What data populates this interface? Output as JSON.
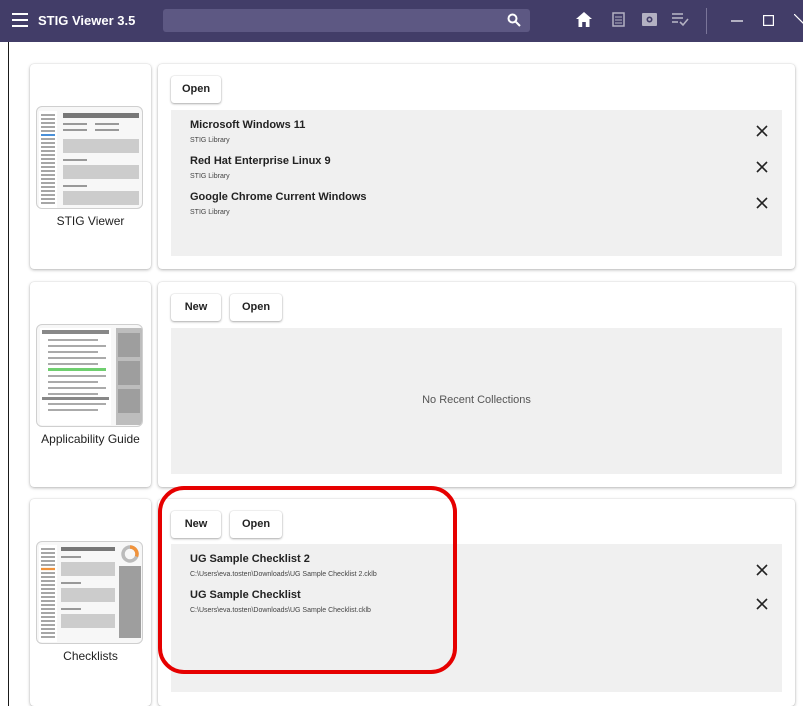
{
  "titlebar": {
    "title": "STIG Viewer 3.5",
    "search_placeholder": "",
    "icons": [
      "home-icon",
      "document-list-icon",
      "image-icon",
      "checklist-icon"
    ],
    "colors": {
      "background": "#423d68",
      "search": "#5d5883"
    }
  },
  "sections": [
    {
      "tile_label": "STIG Viewer",
      "buttons": {
        "open": "Open"
      },
      "items": [
        {
          "name": "Microsoft Windows 11",
          "source": "STIG Library"
        },
        {
          "name": "Red Hat Enterprise Linux 9",
          "source": "STIG Library"
        },
        {
          "name": "Google Chrome Current Windows",
          "source": "STIG Library"
        }
      ]
    },
    {
      "tile_label": "Applicability Guide",
      "buttons": {
        "new": "New",
        "open": "Open"
      },
      "empty_message": "No Recent Collections"
    },
    {
      "tile_label": "Checklists",
      "buttons": {
        "new": "New",
        "open": "Open"
      },
      "items": [
        {
          "name": "UG Sample Checklist 2",
          "path": "C:\\Users\\eva.tosten\\Downloads\\UG Sample Checklist 2.cklb"
        },
        {
          "name": "UG Sample Checklist",
          "path": "C:\\Users\\eva.tosten\\Downloads\\UG Sample Checklist.cklb"
        }
      ]
    }
  ],
  "annotation": {
    "color": "#e60000"
  }
}
